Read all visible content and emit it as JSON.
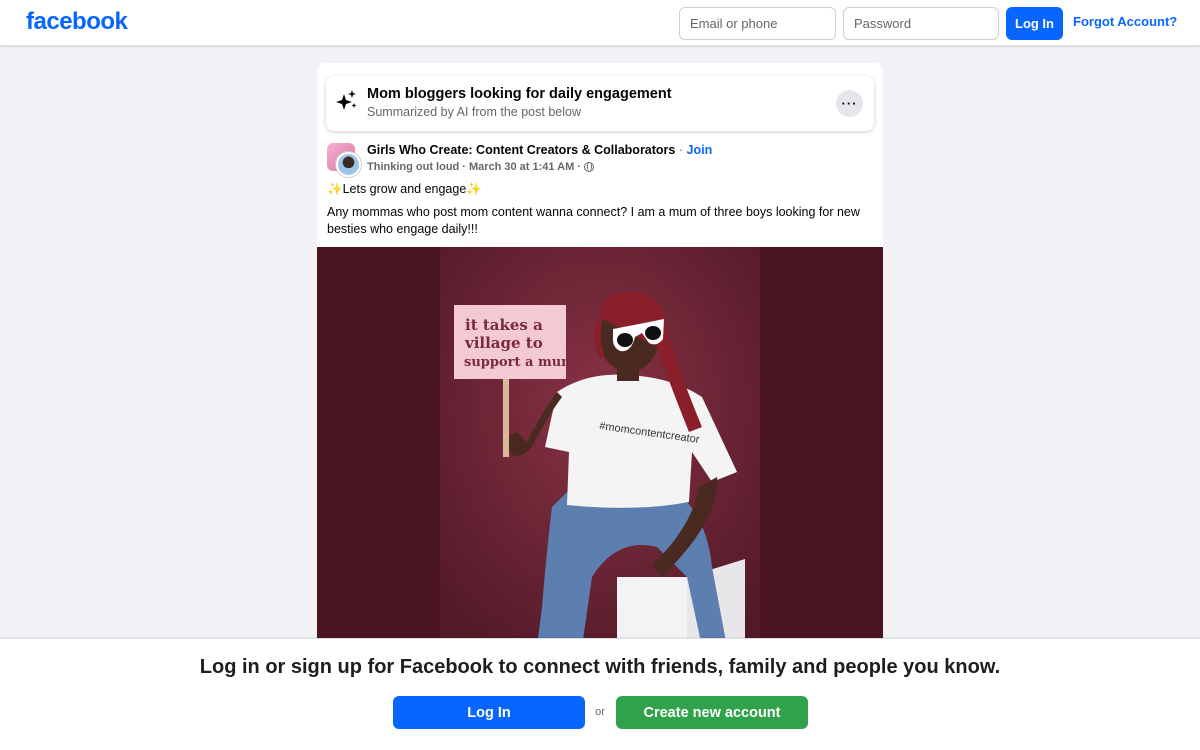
{
  "header": {
    "logo": "facebook",
    "email_placeholder": "Email or phone",
    "password_placeholder": "Password",
    "login_label": "Log In",
    "forgot_label": "Forgot Account?",
    "brand_color": "#0866ff"
  },
  "summary": {
    "icon": "ai-sparkle-icon",
    "title": "Mom bloggers looking for daily engagement",
    "subtitle": "Summarized by AI from the post below",
    "more_label": "···"
  },
  "post": {
    "group_name": "Girls Who Create: Content Creators & Collaborators",
    "separator": "·",
    "join_label": "Join",
    "author": "Thinking out loud",
    "date": "March 30 at 1:41 AM",
    "privacy_icon": "globe-icon",
    "line1_text": "Lets grow and engage",
    "sparkle_glyph": "✨",
    "body": "Any mommas who post mom content wanna connect? I am a mum of three boys looking for new besties who engage daily!!!",
    "photo": {
      "sign_line1": "it takes a",
      "sign_line2": "village to",
      "sign_line3": "support a mum",
      "shirt_text": "#momcontentcreator",
      "background_color": "#4a1520"
    }
  },
  "banner": {
    "text": "Log in or sign up for Facebook to connect with friends, family and people you know.",
    "login_label": "Log In",
    "or_label": "or",
    "create_label": "Create new account",
    "create_color": "#31a24c"
  }
}
